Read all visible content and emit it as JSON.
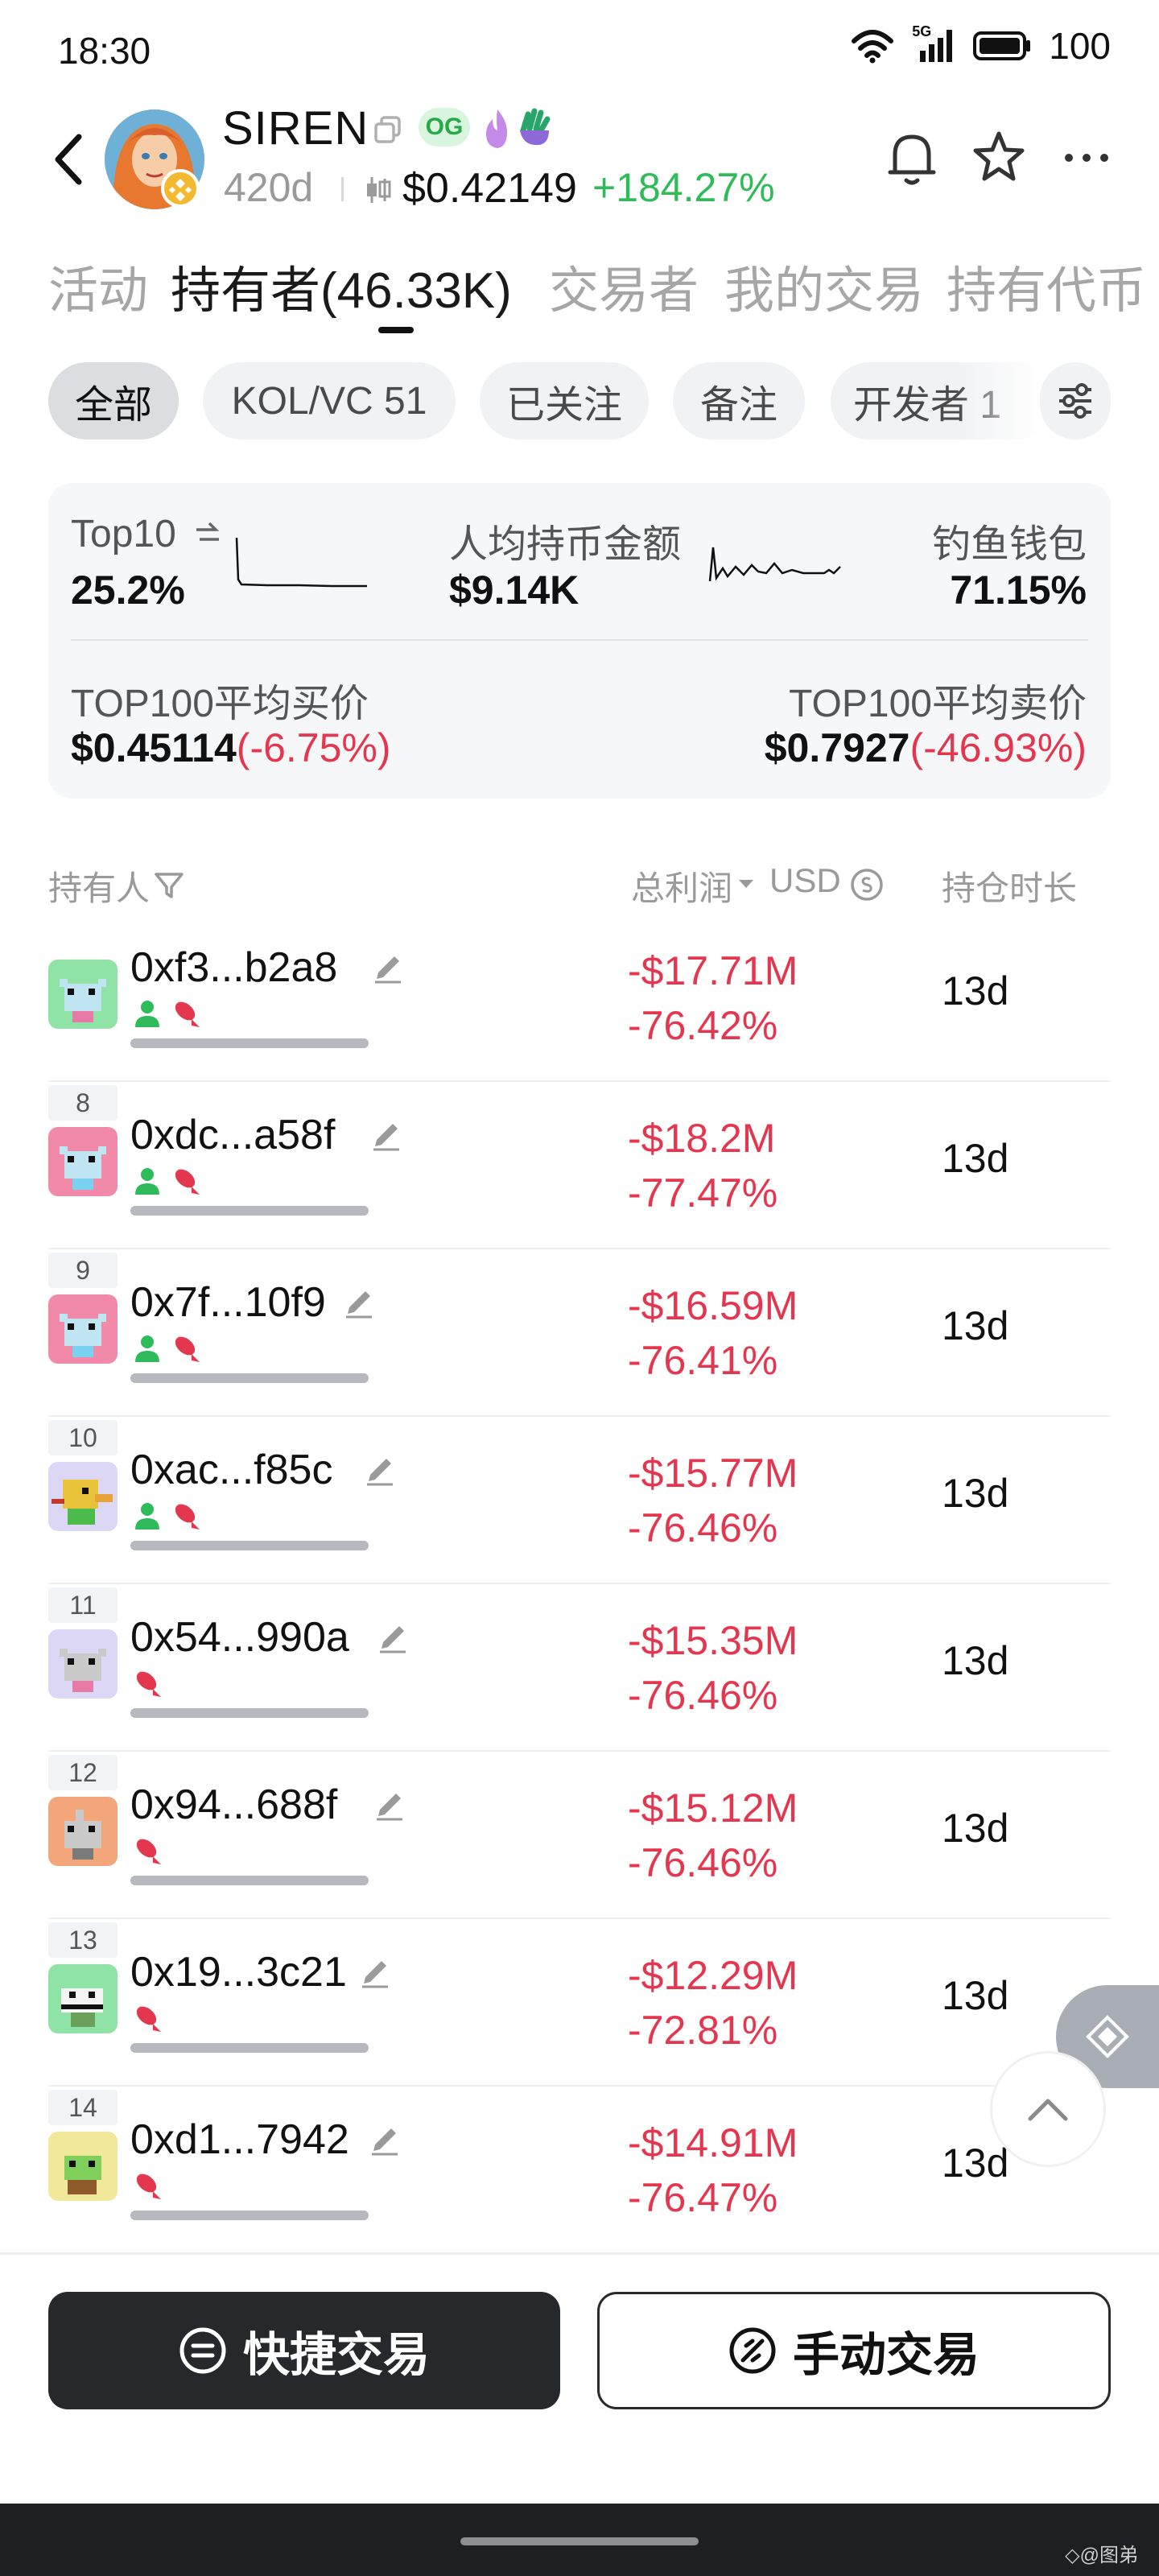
{
  "status_bar": {
    "time": "18:30",
    "battery": "100",
    "network_label": "5G"
  },
  "token": {
    "name": "SIREN",
    "og_label": "OG",
    "age": "420d",
    "price": "$0.42149",
    "change": "+184.27%",
    "change_color": "#2fbb5a"
  },
  "tabs": [
    {
      "label": "活动"
    },
    {
      "label": "持有者(46.33K)"
    },
    {
      "label": "交易者"
    },
    {
      "label": "我的交易"
    },
    {
      "label": "持有代币"
    }
  ],
  "filters": [
    {
      "label": "全部"
    },
    {
      "label": "KOL/VC 51"
    },
    {
      "label": "已关注"
    },
    {
      "label": "备注"
    },
    {
      "label": "开发者 1"
    }
  ],
  "stats": {
    "top10_label": "Top10",
    "top10_value": "25.2%",
    "avg_hold_label": "人均持币金额",
    "avg_hold_value": "$9.14K",
    "phishing_label": "钓鱼钱包",
    "phishing_value": "71.15%",
    "avg_buy_label": "TOP100平均买价",
    "avg_buy_price": "$0.45114",
    "avg_buy_change": "(-6.75%)",
    "avg_sell_label": "TOP100平均卖价",
    "avg_sell_price": "$0.7927",
    "avg_sell_change": "(-46.93%)"
  },
  "list_header": {
    "holder": "持有人",
    "profit": "总利润",
    "currency": "USD",
    "duration": "持仓时长"
  },
  "holders": [
    {
      "rank": "",
      "address": "0xf3...b2a8",
      "profit": "-$17.71M",
      "profit_pct": "-76.42%",
      "duration": "13d",
      "avatar_bg": "#8fe3a6",
      "has_user_tag": true
    },
    {
      "rank": "8",
      "address": "0xdc...a58f",
      "profit": "-$18.2M",
      "profit_pct": "-77.47%",
      "duration": "13d",
      "avatar_bg": "#f08aa8",
      "has_user_tag": true
    },
    {
      "rank": "9",
      "address": "0x7f...10f9",
      "profit": "-$16.59M",
      "profit_pct": "-76.41%",
      "duration": "13d",
      "avatar_bg": "#f08aa8",
      "has_user_tag": true
    },
    {
      "rank": "10",
      "address": "0xac...f85c",
      "profit": "-$15.77M",
      "profit_pct": "-76.46%",
      "duration": "13d",
      "avatar_bg": "#dcd7f5",
      "has_user_tag": true
    },
    {
      "rank": "11",
      "address": "0x54...990a",
      "profit": "-$15.35M",
      "profit_pct": "-76.46%",
      "duration": "13d",
      "avatar_bg": "#dcd7f5",
      "has_user_tag": false
    },
    {
      "rank": "12",
      "address": "0x94...688f",
      "profit": "-$15.12M",
      "profit_pct": "-76.46%",
      "duration": "13d",
      "avatar_bg": "#f3a67a",
      "has_user_tag": false
    },
    {
      "rank": "13",
      "address": "0x19...3c21",
      "profit": "-$12.29M",
      "profit_pct": "-72.81%",
      "duration": "13d",
      "avatar_bg": "#8fe3a6",
      "has_user_tag": false
    },
    {
      "rank": "14",
      "address": "0xd1...7942",
      "profit": "-$14.91M",
      "profit_pct": "-76.47%",
      "duration": "13d",
      "avatar_bg": "#f2e89a",
      "has_user_tag": false
    }
  ],
  "actions": {
    "quick_trade": "快捷交易",
    "manual_trade": "手动交易"
  },
  "watermark": "◇@图弟",
  "colors": {
    "negative": "#e5364f",
    "positive": "#2fbb5a",
    "dark_button": "#27282c"
  }
}
